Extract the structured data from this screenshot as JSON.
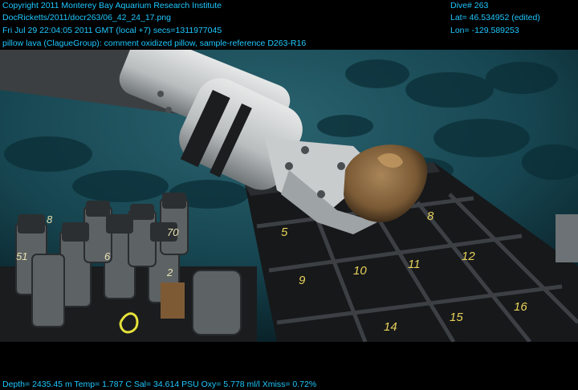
{
  "header": {
    "copyright": "Copyright 2011 Monterey Bay Aquarium Research Institute",
    "file_path": "DocRicketts/2011/docr263/06_42_24_17.png",
    "timestamp": "Fri Jul 29 22:04:05 2011 GMT (local +7)  secs=1311977045",
    "annotation": "pillow lava (ClagueGroup): comment oxidized pillow, sample-reference D263-R16"
  },
  "nav": {
    "dive": "Dive# 263",
    "lat": "Lat= 46.534952 (edited)",
    "lon": "Lon= -129.589253"
  },
  "footer": {
    "telemetry": "Depth= 2435.45 m  Temp= 1.787 C  Sal= 34.614 PSU  Oxy= 5.778 ml/l  Xmiss= 0.72%"
  },
  "scene": {
    "crate_numbers": [
      "5",
      "8",
      "9",
      "10",
      "11",
      "12",
      "14",
      "15",
      "16"
    ],
    "tube_labels": [
      "8",
      "51",
      "70",
      "2",
      "6"
    ]
  },
  "colors": {
    "overlay_text": "#1ec8ff",
    "seawater": "#0f3a44",
    "crate": "#141618",
    "rock": "#8a6a42"
  }
}
